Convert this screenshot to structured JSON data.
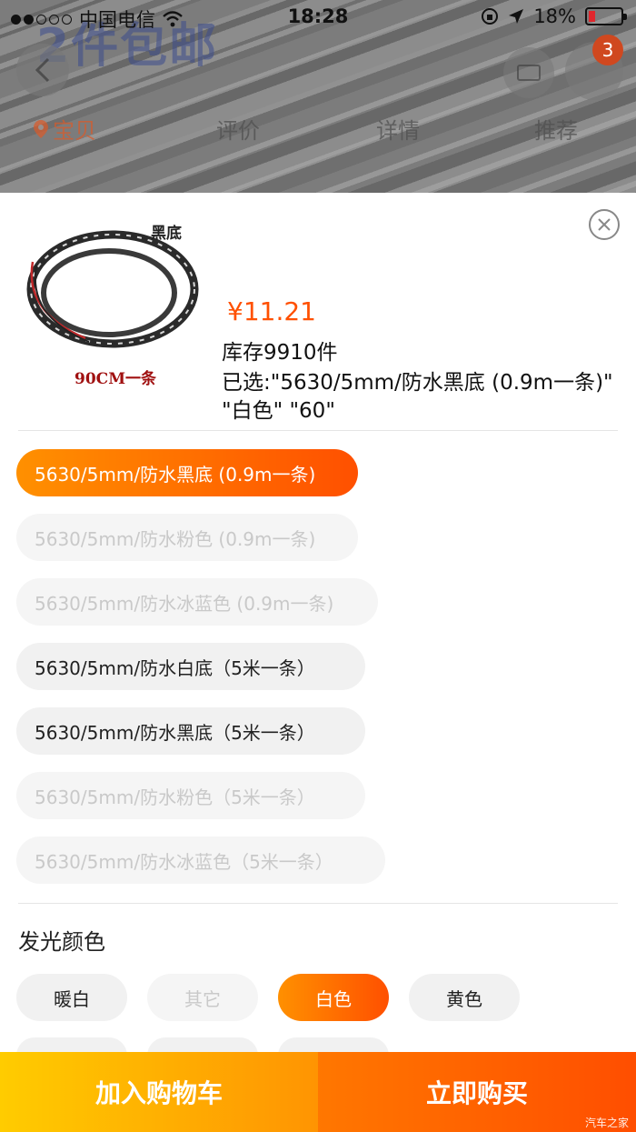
{
  "status_bar": {
    "carrier": "中国电信",
    "time": "18:28",
    "battery": "18%"
  },
  "background_page": {
    "promo_text": "2件包邮",
    "cart_badge": "3",
    "tabs": [
      "宝贝",
      "评价",
      "详情",
      "推荐"
    ]
  },
  "sku_sheet": {
    "thumbnail": {
      "label_top": "黑底",
      "label_bottom": "90CM一条"
    },
    "price": "¥11.21",
    "stock": "库存9910件",
    "selected": "已选:\"5630/5mm/防水黑底 (0.9m一条)\" \"白色\" \"60\"",
    "spec_options": [
      {
        "label": "5630/5mm/防水黑底 (0.9m一条)",
        "state": "selected"
      },
      {
        "label": "5630/5mm/防水粉色 (0.9m一条)",
        "state": "disabled"
      },
      {
        "label": "5630/5mm/防水冰蓝色 (0.9m一条)",
        "state": "disabled"
      },
      {
        "label": "5630/5mm/防水白底（5米一条）",
        "state": "available"
      },
      {
        "label": "5630/5mm/防水黑底（5米一条）",
        "state": "available"
      },
      {
        "label": "5630/5mm/防水粉色（5米一条）",
        "state": "disabled"
      },
      {
        "label": "5630/5mm/防水冰蓝色（5米一条）",
        "state": "disabled"
      }
    ],
    "color_section_title": "发光颜色",
    "color_options": [
      {
        "label": "暖白",
        "state": "available"
      },
      {
        "label": "其它",
        "state": "disabled"
      },
      {
        "label": "白色",
        "state": "selected"
      },
      {
        "label": "黄色",
        "state": "available"
      }
    ]
  },
  "bottom_bar": {
    "add_to_cart": "加入购物车",
    "buy_now": "立即购买"
  },
  "watermark": "汽车之家",
  "colors": {
    "accent": "#ff5000",
    "cart_gradient": [
      "#ffcc00",
      "#ff9402"
    ],
    "buy_gradient": [
      "#ff7700",
      "#ff4e00"
    ]
  }
}
